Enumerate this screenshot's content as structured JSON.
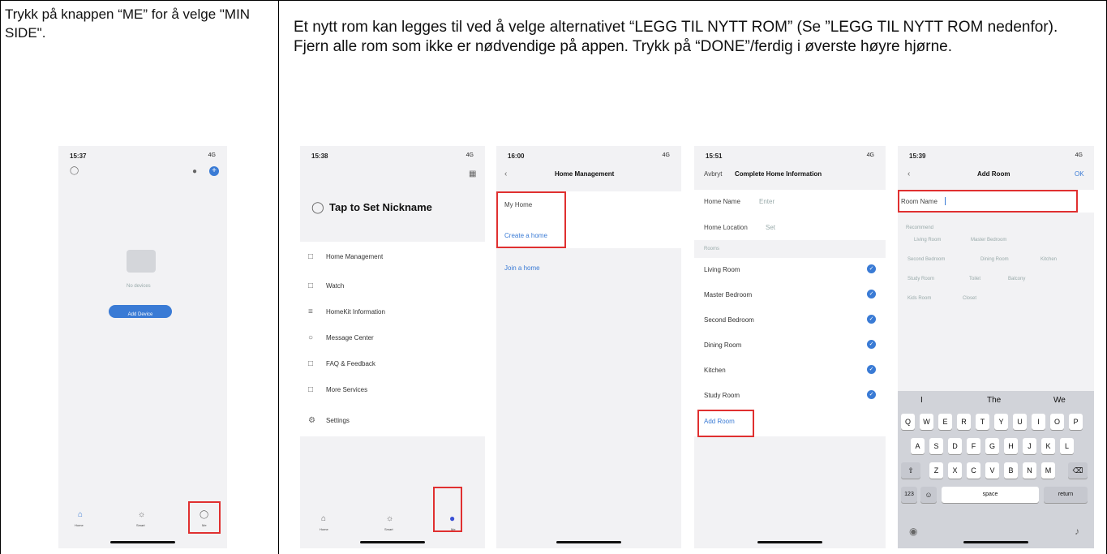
{
  "instructions": {
    "left": "Trykk på knappen “ME” for å velge \"MIN SIDE\".",
    "right": "Et nytt rom kan legges til ved å velge alternativet “LEGG TIL NYTT ROM” (Se ”LEGG TIL NYTT ROM nedenfor). Fjern alle rom som ikke er nødvendige på appen. Trykk på “DONE”/ferdig i øverste høyre hjørne."
  },
  "screen1": {
    "time": "15:37",
    "signal": "4G",
    "no_devices": "No devices",
    "add_device": "Add Device",
    "tabs": [
      "Home",
      "Smart",
      "Me"
    ]
  },
  "screen2": {
    "time": "15:38",
    "signal": "4G",
    "nickname": "Tap to Set Nickname",
    "menu": [
      "Home Management",
      "Watch",
      "HomeKit Information",
      "Message Center",
      "FAQ & Feedback",
      "More Services",
      "Settings"
    ],
    "tabs": [
      "Home",
      "Smart",
      "Me"
    ]
  },
  "screen3": {
    "time": "16:00",
    "signal": "4G",
    "title": "Home Management",
    "items": [
      "My Home",
      "Create a home",
      "Join a home"
    ]
  },
  "screen4": {
    "time": "15:51",
    "signal": "4G",
    "cancel": "Avbryt",
    "title": "Complete Home Information",
    "home_name": "Home Name",
    "enter": "Enter",
    "home_location": "Home Location",
    "set": "Set",
    "rooms_header": "Rooms",
    "rooms": [
      "Living Room",
      "Master Bedroom",
      "Second Bedroom",
      "Dining Room",
      "Kitchen",
      "Study Room"
    ],
    "add_room": "Add Room"
  },
  "screen5": {
    "time": "15:39",
    "signal": "4G",
    "title": "Add Room",
    "ok": "OK",
    "room_name": "Room Name",
    "recommend": "Recommend",
    "suggestions": [
      "Living Room",
      "Master Bedroom",
      "Second Bedroom",
      "Dining Room",
      "Kitchen",
      "Study Room",
      "Toilet",
      "Balcony",
      "Kids Room",
      "Closet"
    ],
    "predictions": [
      "I",
      "The",
      "We"
    ],
    "row1": [
      "Q",
      "W",
      "E",
      "R",
      "T",
      "Y",
      "U",
      "I",
      "O",
      "P"
    ],
    "row2": [
      "A",
      "S",
      "D",
      "F",
      "G",
      "H",
      "J",
      "K",
      "L"
    ],
    "row3": [
      "Z",
      "X",
      "C",
      "V",
      "B",
      "N",
      "M"
    ],
    "num_key": "123",
    "space": "space",
    "return": "return"
  }
}
